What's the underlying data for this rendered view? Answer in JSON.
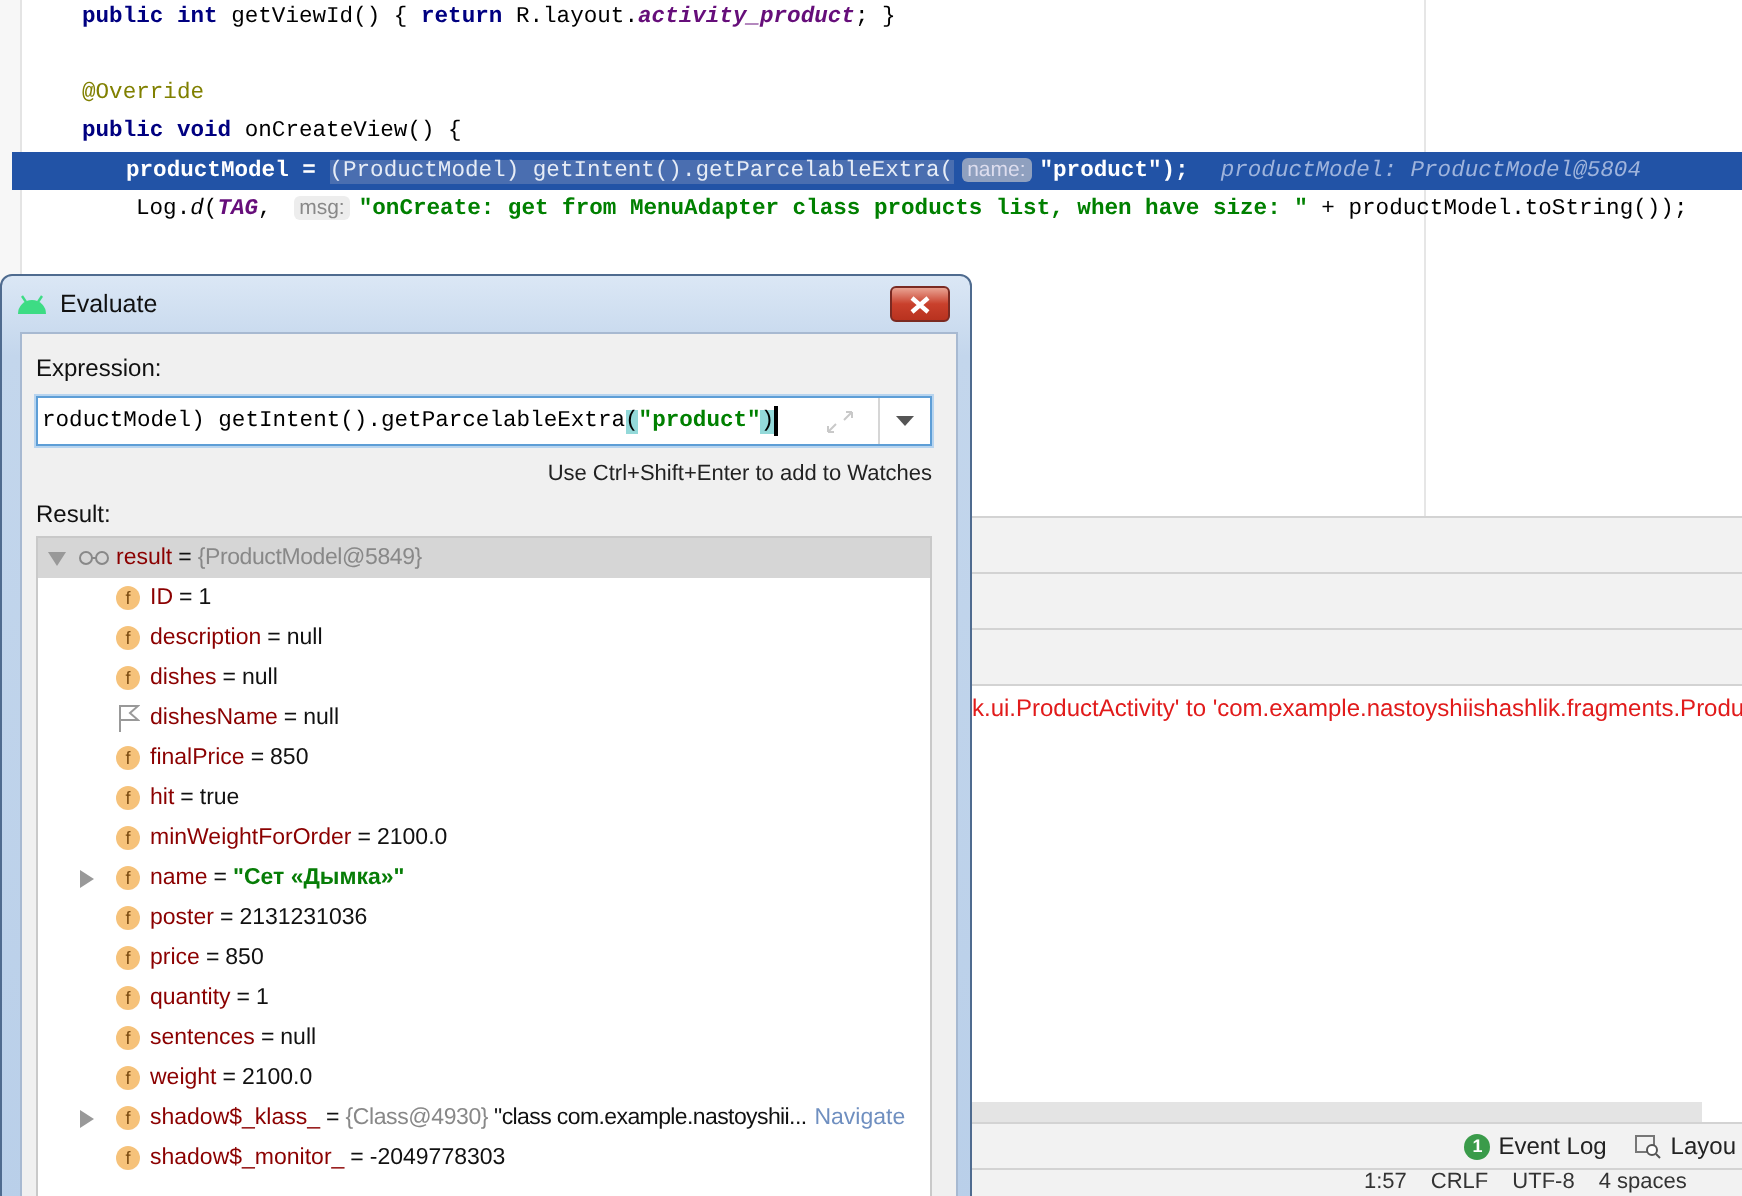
{
  "editor": {
    "lines": [
      {
        "highlighted": false,
        "segments": [
          {
            "kind": "kw",
            "text": "public int "
          },
          {
            "kind": "plain",
            "text": "getViewId() { "
          },
          {
            "kind": "kw",
            "text": "return "
          },
          {
            "kind": "plain",
            "text": "R.layout."
          },
          {
            "kind": "field",
            "text": "activity_product"
          },
          {
            "kind": "plain",
            "text": "; }"
          }
        ]
      },
      {
        "highlighted": false
      },
      {
        "highlighted": false,
        "segments": [
          {
            "kind": "anno",
            "text": "@Override"
          }
        ]
      },
      {
        "highlighted": false,
        "segments": [
          {
            "kind": "kw",
            "text": "public void "
          },
          {
            "kind": "plain",
            "text": "onCreateView() {"
          }
        ],
        "children": [
          {
            "highlighted": true,
            "segments": [
              {
                "kind": "plain",
                "text": "productModel = "
              },
              {
                "kind": "sel",
                "text": "(ProductModel) getIntent().getParcelableExtra("
              },
              {
                "kind": "hint",
                "text": "name:"
              },
              {
                "kind": "str",
                "text": "\"product\""
              },
              {
                "kind": "plain",
                "text": ");"
              },
              {
                "kind": "debug",
                "text": "productModel: ProductModel@5804"
              }
            ]
          },
          {
            "highlighted": false,
            "segments": [
              {
                "kind": "plain",
                "text": "Log."
              },
              {
                "kind": "static",
                "text": "d"
              },
              {
                "kind": "plain",
                "text": "("
              },
              {
                "kind": "field",
                "text": "TAG"
              },
              {
                "kind": "plain",
                "text": ", "
              },
              {
                "kind": "hint",
                "text": "msg:"
              },
              {
                "kind": "str",
                "text": "\"onCreate: get from MenuAdapter class products list, when have size: \""
              },
              {
                "kind": "plain",
                "text": " + productModel.toString());"
              }
            ]
          }
        ]
      }
    ]
  },
  "console": {
    "error_line": "k.ui.ProductActivity' to 'com.example.nastoyshiishashlik.fragments.Produ"
  },
  "tool_bar": {
    "items": [
      {
        "kind": "event",
        "label": "Event Log",
        "badge": "1"
      },
      {
        "kind": "layout",
        "label": "Layou"
      }
    ]
  },
  "status_bar": {
    "items": [
      "1:57",
      "CRLF",
      "UTF-8",
      "4 spaces"
    ]
  },
  "dialog": {
    "title": "Evaluate",
    "expression_label": "Expression:",
    "expression": [
      {
        "kind": "plain",
        "text": "roductModel) getIntent().getParcelableExtra"
      },
      {
        "kind": "brace",
        "text": "("
      },
      {
        "kind": "str",
        "text": "\"product\""
      },
      {
        "kind": "brace",
        "text": ")"
      }
    ],
    "hint": "Use Ctrl+Shift+Enter to add to Watches",
    "result_label": "Result:",
    "result": {
      "name": "result",
      "eq": "=",
      "type_ref": "{ProductModel@5849}",
      "selected": true,
      "expanded": true,
      "children": [
        {
          "kind": "field",
          "icon_text": "f",
          "name": "ID",
          "eq": "=",
          "value": "1",
          "has_children": false,
          "expanded": false
        },
        {
          "kind": "field",
          "icon_text": "f",
          "name": "description",
          "eq": "=",
          "value": "null",
          "has_children": false,
          "expanded": false
        },
        {
          "kind": "field",
          "icon_text": "f",
          "name": "dishes",
          "eq": "=",
          "value": "null",
          "has_children": false,
          "expanded": false
        },
        {
          "kind": "flag",
          "name": "dishesName",
          "eq": "=",
          "value": "null",
          "has_children": false,
          "expanded": false
        },
        {
          "kind": "field",
          "icon_text": "f",
          "name": "finalPrice",
          "eq": "=",
          "value": "850",
          "has_children": false,
          "expanded": false
        },
        {
          "kind": "field",
          "icon_text": "f",
          "name": "hit",
          "eq": "=",
          "value": "true",
          "has_children": false,
          "expanded": false
        },
        {
          "kind": "field",
          "icon_text": "f",
          "name": "minWeightForOrder",
          "eq": "=",
          "value": "2100.0",
          "has_children": false,
          "expanded": false
        },
        {
          "kind": "field",
          "icon_text": "f",
          "name": "name",
          "eq": "=",
          "string_value": "\"Сет «Дымка»\"",
          "has_children": true,
          "expanded": false
        },
        {
          "kind": "field",
          "icon_text": "f",
          "name": "poster",
          "eq": "=",
          "value": "2131231036",
          "has_children": false,
          "expanded": false
        },
        {
          "kind": "field",
          "icon_text": "f",
          "name": "price",
          "eq": "=",
          "value": "850",
          "has_children": false,
          "expanded": false
        },
        {
          "kind": "field",
          "icon_text": "f",
          "name": "quantity",
          "eq": "=",
          "value": "1",
          "has_children": false,
          "expanded": false
        },
        {
          "kind": "field",
          "icon_text": "f",
          "name": "sentences",
          "eq": "=",
          "value": "null",
          "has_children": false,
          "expanded": false
        },
        {
          "kind": "field",
          "icon_text": "f",
          "name": "weight",
          "eq": "=",
          "value": "2100.0",
          "has_children": false,
          "expanded": false
        },
        {
          "kind": "field",
          "icon_text": "f",
          "name": "shadow$_klass_",
          "eq": "=",
          "type_ref": "{Class@4930}",
          "value": "\"class com.example.nastoyshii...",
          "link": "Navigate",
          "has_children": true,
          "expanded": false
        },
        {
          "kind": "field",
          "icon_text": "f",
          "name": "shadow$_monitor_",
          "eq": "=",
          "value": "-2049778303",
          "has_children": false,
          "expanded": false
        }
      ]
    }
  }
}
